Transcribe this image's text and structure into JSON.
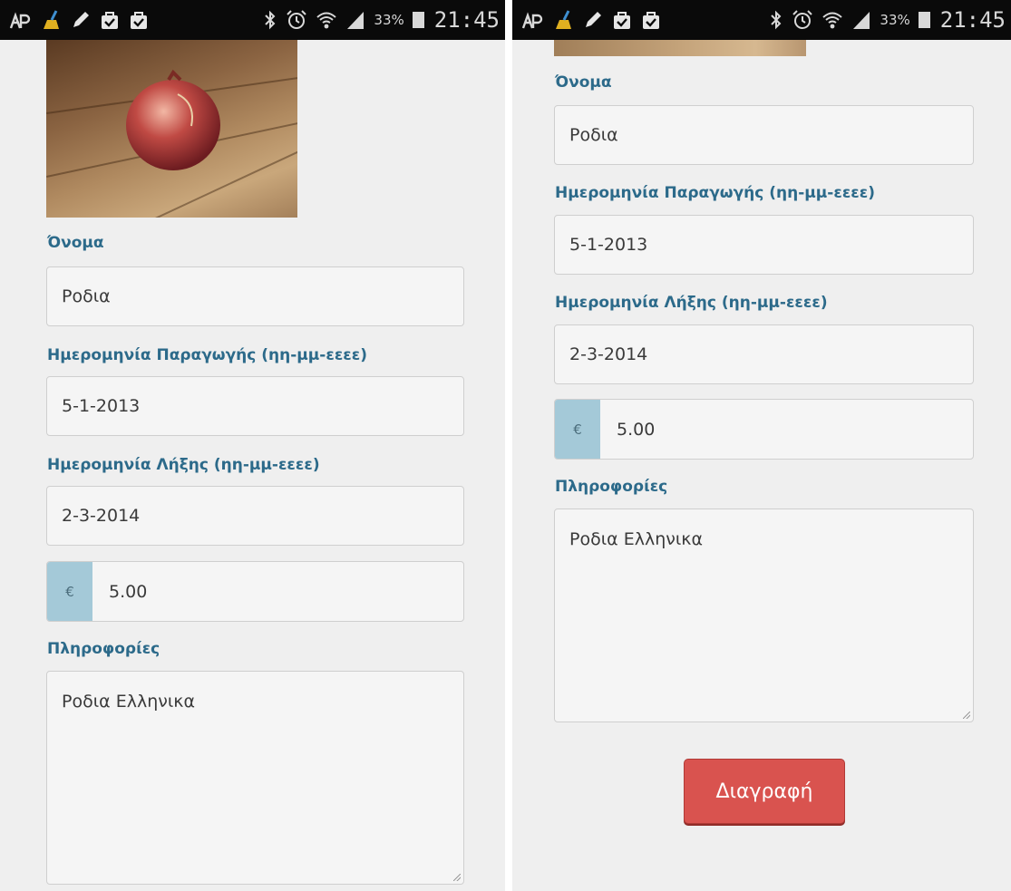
{
  "status_bar": {
    "battery": "33%",
    "time": "21:45",
    "icons": [
      "debug-icon",
      "cleaner-icon",
      "pencil-icon",
      "bag-icon",
      "bag-check-icon",
      "bluetooth-icon",
      "alarm-icon",
      "wifi-icon",
      "signal-icon",
      "battery-icon"
    ]
  },
  "form": {
    "name_label": "Όνομα",
    "name_value": "Ροδια",
    "production_date_label": "Ημερομηνία Παραγωγής (ηη-μμ-εεεε)",
    "production_date_value": "5-1-2013",
    "expiry_date_label": "Ημερομηνία Λήξης (ηη-μμ-εεεε)",
    "expiry_date_value": "2-3-2014",
    "currency_symbol": "€",
    "price_value": "5.00",
    "info_label": "Πληροφορίες",
    "info_value": "Ροδια Ελληνικα",
    "delete_button": "Διαγραφή"
  },
  "colors": {
    "label": "#2c6a8a",
    "addon": "#a4c9d8",
    "delete": "#d9534f"
  }
}
